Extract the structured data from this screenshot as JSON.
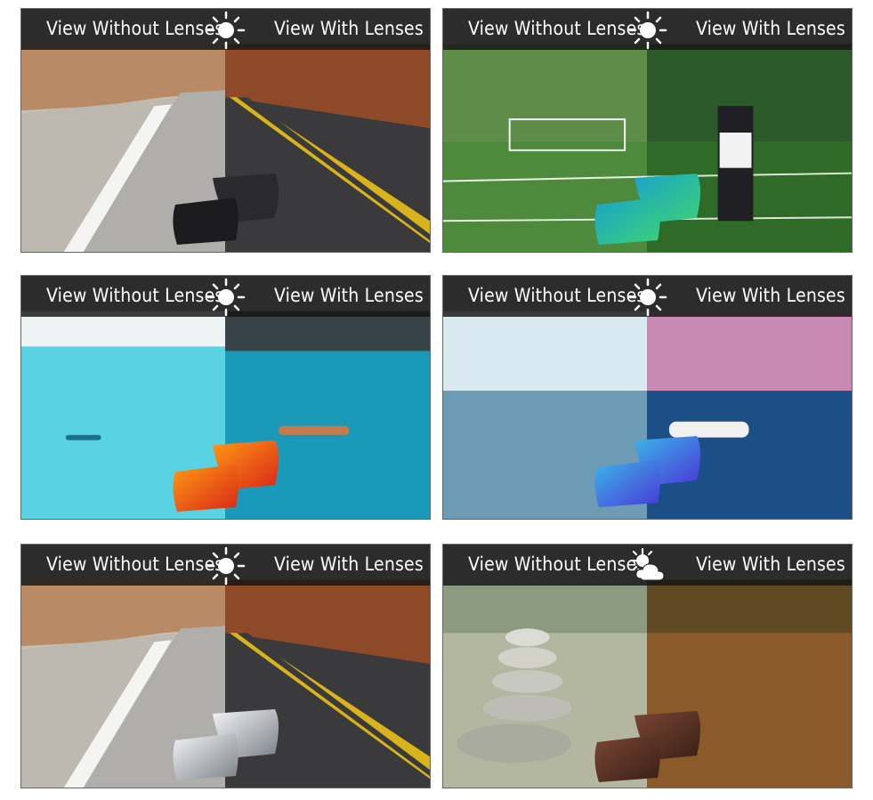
{
  "panels": [
    {
      "without_label": "View Without Lenses",
      "with_label": "View With Lenses",
      "weather_icon": "sun-icon",
      "scene": "desert-road",
      "lens_color": "#1f1f22"
    },
    {
      "without_label": "View Without Lenses",
      "with_label": "View With Lenses",
      "weather_icon": "sun-icon",
      "scene": "football-field",
      "lens_color": "#2fbf8f"
    },
    {
      "without_label": "View Without Lenses",
      "with_label": "View With Lenses",
      "weather_icon": "sun-icon",
      "scene": "marina-paddleboard",
      "lens_color": "#e8471d"
    },
    {
      "without_label": "View Without Lenses",
      "with_label": "View With Lenses",
      "weather_icon": "sun-icon",
      "scene": "ocean-jetski",
      "lens_color": "#2e6fe0"
    },
    {
      "without_label": "View Without Lenses",
      "with_label": "View With Lenses",
      "weather_icon": "sun-icon",
      "scene": "desert-road",
      "lens_color": "#b9bdc4"
    },
    {
      "without_label": "View Without Lenses",
      "with_label": "View With Lenses",
      "weather_icon": "sun-cloud-icon",
      "scene": "river-stones",
      "lens_color": "#5a3324"
    }
  ]
}
